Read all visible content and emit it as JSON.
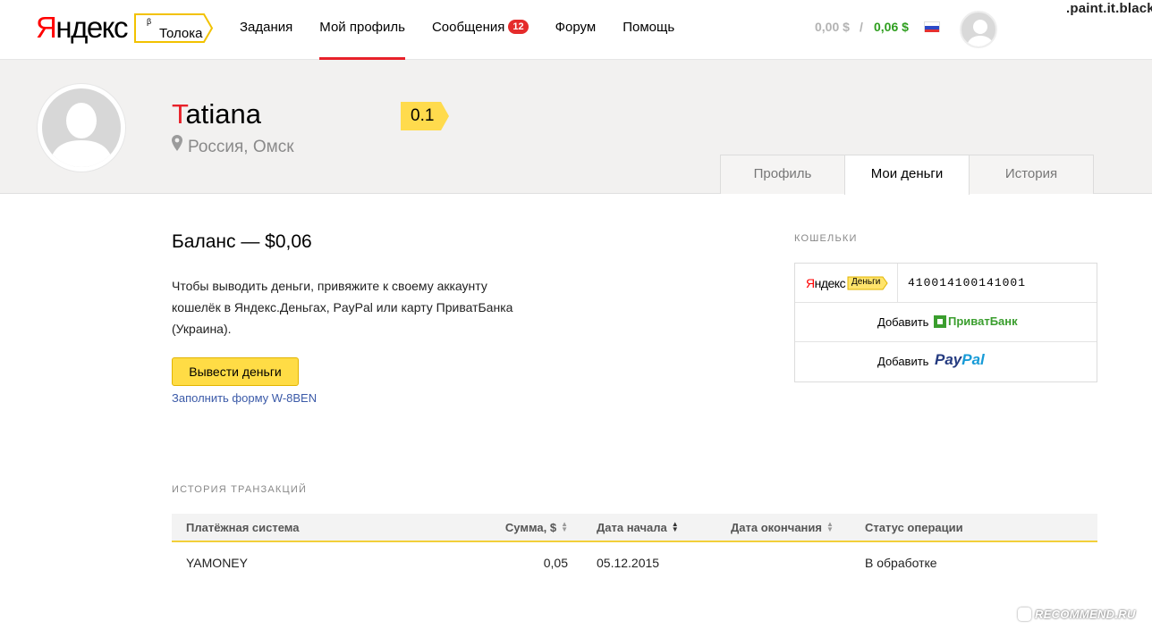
{
  "header": {
    "logo_first": "Я",
    "logo_rest": "ндекс",
    "service": "Толока",
    "service_sup": "β",
    "nav": [
      {
        "label": "Задания"
      },
      {
        "label": "Мой профиль",
        "active": true
      },
      {
        "label": "Сообщения",
        "badge": "12"
      },
      {
        "label": "Форум"
      },
      {
        "label": "Помощь"
      }
    ],
    "balance_pending": "0,00 $",
    "separator": "/",
    "balance_available": "0,06 $",
    "flag_icon": "russia-flag-icon",
    "avatar_icon": "user-avatar-icon",
    "watermark": ".paint.it.black."
  },
  "profile": {
    "name_first": "T",
    "name_rest": "atiana",
    "location": "Россия, Омск",
    "rating": "0.1",
    "tabs": [
      {
        "label": "Профиль"
      },
      {
        "label": "Мои деньги",
        "active": true
      },
      {
        "label": "История"
      }
    ]
  },
  "money": {
    "balance_title": "Баланс — $0,06",
    "balance_text": "Чтобы выводить деньги, привяжите к своему аккаунту кошелёк в Яндекс.Деньгах, PayPal или карту ПриватБанка (Украина).",
    "withdraw_button": "Вывести деньги",
    "w8_link": "Заполнить форму W-8BEN"
  },
  "wallets": {
    "label": "КОШЕЛЬКИ",
    "yandex": {
      "logo_first": "Я",
      "logo_rest": "ндекс",
      "tag": "Деньги",
      "number": "410014100141001"
    },
    "privat": {
      "add_label": "Добавить",
      "brand": "ПриватБанк"
    },
    "paypal": {
      "add_label": "Добавить",
      "brand_pay": "Pay",
      "brand_pal": "Pal"
    }
  },
  "history": {
    "label": "ИСТОРИЯ ТРАНЗАКЦИЙ",
    "columns": {
      "system": "Платёжная система",
      "amount": "Сумма, $",
      "start": "Дата начала",
      "end": "Дата окончания",
      "status": "Статус операции"
    },
    "rows": [
      {
        "system": "YAMONEY",
        "amount": "0,05",
        "start": "05.12.2015",
        "end": "",
        "status": "В обработке"
      }
    ]
  },
  "footer_watermark": "RECOMMEND.RU",
  "colors": {
    "accent_red": "#e8212a",
    "yellow": "#ffdc45",
    "green": "#2e9e1e",
    "link_blue": "#3b5aa8"
  }
}
